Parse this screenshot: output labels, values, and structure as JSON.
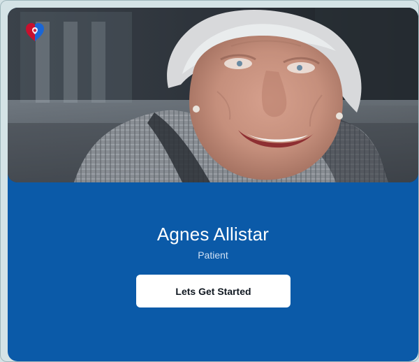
{
  "profile": {
    "name": "Agnes Allistar",
    "role": "Patient"
  },
  "actions": {
    "start_label": "Lets Get Started"
  },
  "brand": {
    "logo_icon": "heart-logo-icon",
    "primary_color": "#0b5aa8",
    "logo_red": "#c8102e",
    "logo_blue": "#1a66d6"
  },
  "photo": {
    "subject": "smiling-woman-photo"
  }
}
